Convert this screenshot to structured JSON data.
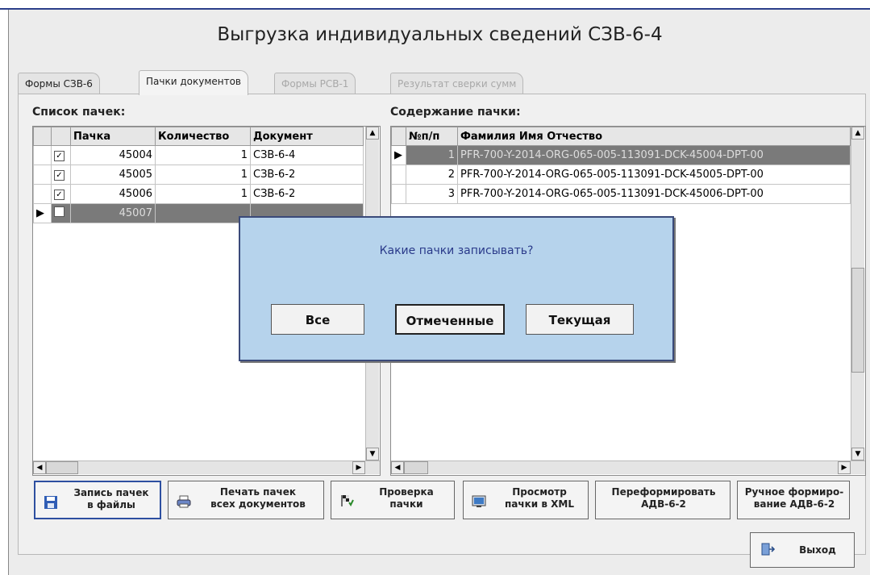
{
  "window": {
    "title": "Выгрузка индивидуальных сведений СЗВ-6-4"
  },
  "tabs": [
    {
      "label": "Формы СЗВ-6",
      "active": false,
      "enabled": true
    },
    {
      "label": "Пачки документов",
      "active": true,
      "enabled": true
    },
    {
      "label": "Формы РСВ-1",
      "active": false,
      "enabled": false
    },
    {
      "label": "Результат сверки сумм",
      "active": false,
      "enabled": false
    }
  ],
  "left_panel": {
    "caption": "Список пачек:",
    "columns": [
      "Пачка",
      "Количество",
      "Документ"
    ],
    "rows": [
      {
        "checked": true,
        "pack": "45004",
        "count": "1",
        "doc": "СЗВ-6-4"
      },
      {
        "checked": true,
        "pack": "45005",
        "count": "1",
        "doc": "СЗВ-6-2"
      },
      {
        "checked": true,
        "pack": "45006",
        "count": "1",
        "doc": "СЗВ-6-2"
      },
      {
        "checked": false,
        "pack": "45007",
        "count": "",
        "doc": "",
        "selected": true
      }
    ]
  },
  "right_panel": {
    "caption": "Содержание пачки:",
    "columns": [
      "№п/п",
      "Фамилия Имя Отчество"
    ],
    "rows": [
      {
        "n": "1",
        "name": "PFR-700-Y-2014-ORG-065-005-113091-DCK-45004-DPT-00",
        "selected": true
      },
      {
        "n": "2",
        "name": "PFR-700-Y-2014-ORG-065-005-113091-DCK-45005-DPT-00",
        "selected": false
      },
      {
        "n": "3",
        "name": "PFR-700-Y-2014-ORG-065-005-113091-DCK-45006-DPT-00",
        "selected": false
      }
    ]
  },
  "dialog": {
    "question": "Какие пачки записывать?",
    "buttons": [
      "Все",
      "Отмеченные",
      "Текущая"
    ]
  },
  "bottom_buttons": [
    {
      "line1": "Запись пачек",
      "line2": "в файлы",
      "icon": "floppy-disk-icon"
    },
    {
      "line1": "Печать пачек",
      "line2": "всех документов",
      "icon": "printer-icon"
    },
    {
      "line1": "Проверка",
      "line2": "пачки",
      "icon": "flag-check-icon"
    },
    {
      "line1": "Просмотр",
      "line2": "пачки в XML",
      "icon": "monitor-icon"
    },
    {
      "line1": "Переформировать",
      "line2": "АДВ-6-2",
      "icon": ""
    },
    {
      "line1": "Ручное формиро-",
      "line2": "вание АДВ-6-2",
      "icon": ""
    }
  ],
  "exit_button": {
    "label": "Выход",
    "icon": "exit-door-icon"
  }
}
